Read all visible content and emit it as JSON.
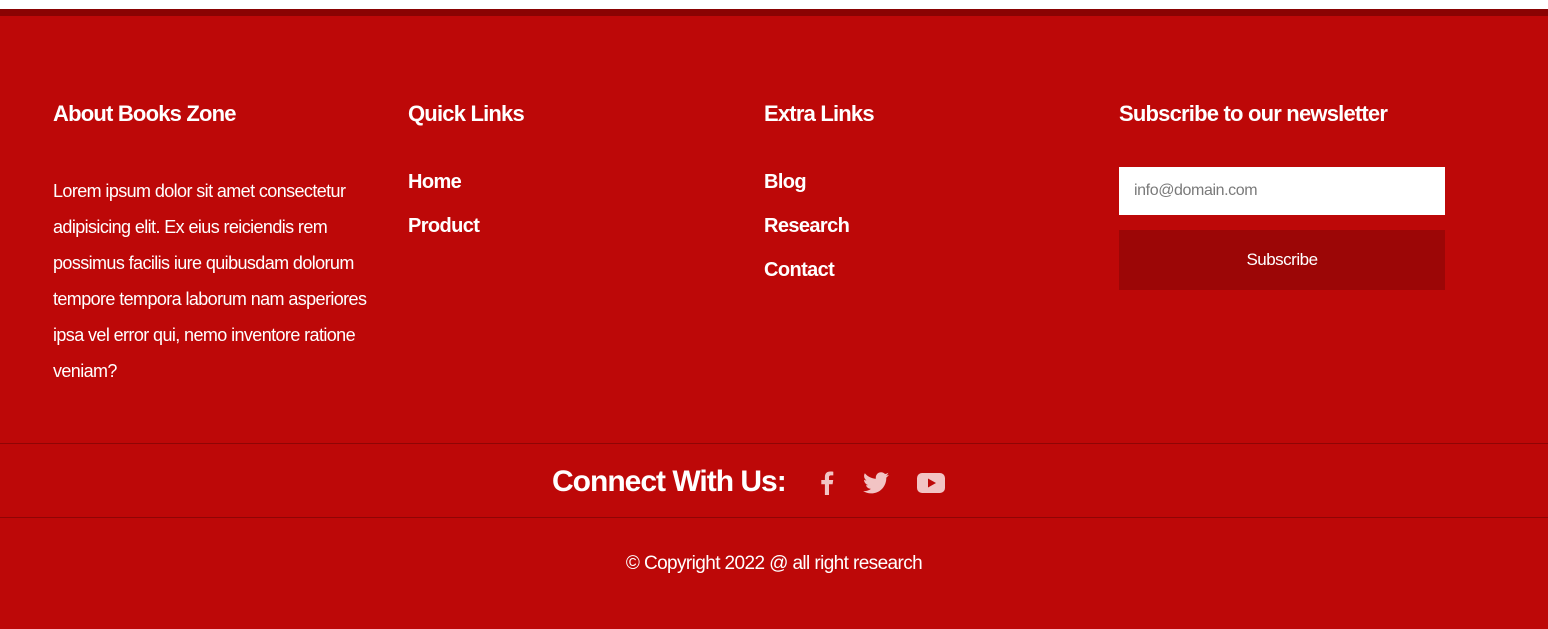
{
  "about": {
    "title": "About Books Zone",
    "text": "Lorem ipsum dolor sit amet consectetur adipisicing elit. Ex eius reiciendis rem possimus facilis iure quibusdam dolorum tempore tempora laborum nam asperiores ipsa vel error qui, nemo inventore ratione veniam?"
  },
  "quick_links": {
    "title": "Quick Links",
    "items": [
      "Home",
      "Product"
    ]
  },
  "extra_links": {
    "title": "Extra Links",
    "items": [
      "Blog",
      "Research",
      "Contact"
    ]
  },
  "newsletter": {
    "title": "Subscribe to our newsletter",
    "placeholder": "info@domain.com",
    "button_label": "Subscribe"
  },
  "connect": {
    "title": "Connect With Us:",
    "icons": [
      "facebook-icon",
      "twitter-icon",
      "youtube-icon"
    ]
  },
  "copyright": "© Copyright 2022 @ all right research",
  "colors": {
    "footer_bg": "#bd0808",
    "top_border": "#8a0303",
    "button_bg": "#9c0606",
    "icon_color": "#f2c4c4",
    "text": "#ffffff"
  }
}
